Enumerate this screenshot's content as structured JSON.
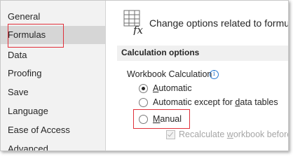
{
  "sidebar": {
    "items": [
      {
        "label": "General"
      },
      {
        "label": "Formulas",
        "active": true
      },
      {
        "label": "Data"
      },
      {
        "label": "Proofing"
      },
      {
        "label": "Save"
      },
      {
        "label": "Language"
      },
      {
        "label": "Ease of Access"
      },
      {
        "label": "Advanced"
      }
    ]
  },
  "main": {
    "header": {
      "icon": "formula-fx-icon",
      "text": "Change options related to formula calculation, performance, and error handling."
    },
    "section": {
      "title": "Calculation options"
    },
    "workbook_calc": {
      "label": "Workbook Calculation",
      "info_icon": "info-icon",
      "options": [
        {
          "prefix": "",
          "underlined": "A",
          "suffix": "utomatic",
          "checked": true
        },
        {
          "prefix": "Automatic except for ",
          "underlined": "d",
          "suffix": "ata tables",
          "checked": false
        },
        {
          "prefix": "",
          "underlined": "M",
          "suffix": "anual",
          "checked": false
        }
      ]
    },
    "recalc": {
      "prefix": "Recalculate ",
      "underlined": "w",
      "suffix": "orkbook before saving",
      "checked": true,
      "disabled": true
    }
  },
  "highlight_color": "#e0303a",
  "accent_color": "#2b7cd3"
}
